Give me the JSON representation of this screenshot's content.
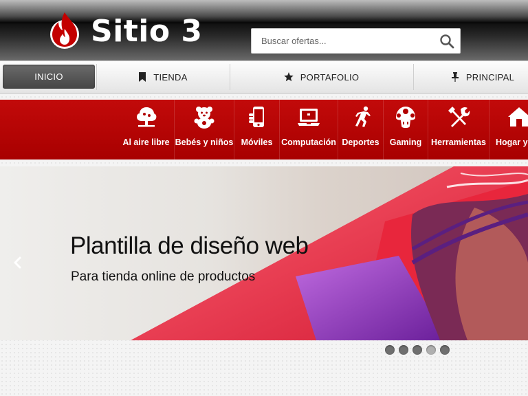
{
  "brand": {
    "name": "Sitio 3",
    "red": "#c20a0a"
  },
  "search": {
    "placeholder": "Buscar ofertas...",
    "icon": "search-icon"
  },
  "nav": {
    "items": [
      {
        "label": "INICIO",
        "icon": null,
        "active": true
      },
      {
        "label": "TIENDA",
        "icon": "bookmark-icon"
      },
      {
        "label": "PORTAFOLIO",
        "icon": "star-icon"
      },
      {
        "label": "PRINCIPAL",
        "icon": "pin-icon"
      }
    ]
  },
  "categories": [
    {
      "label": "Al aire libre",
      "icon": "tree-icon"
    },
    {
      "label": "Bebés y niños",
      "icon": "teddy-bear-icon"
    },
    {
      "label": "Móviles",
      "icon": "mobile-phone-icon"
    },
    {
      "label": "Computación",
      "icon": "laptop-icon"
    },
    {
      "label": "Deportes",
      "icon": "runner-icon"
    },
    {
      "label": "Gaming",
      "icon": "mushroom-icon"
    },
    {
      "label": "Herramientas",
      "icon": "tools-icon"
    },
    {
      "label": "Hogar y J",
      "icon": "home-icon"
    }
  ],
  "hero": {
    "title": "Plantilla de diseño web",
    "subtitle": "Para tienda online de productos",
    "active_slide": 4,
    "slide_count": 5
  }
}
